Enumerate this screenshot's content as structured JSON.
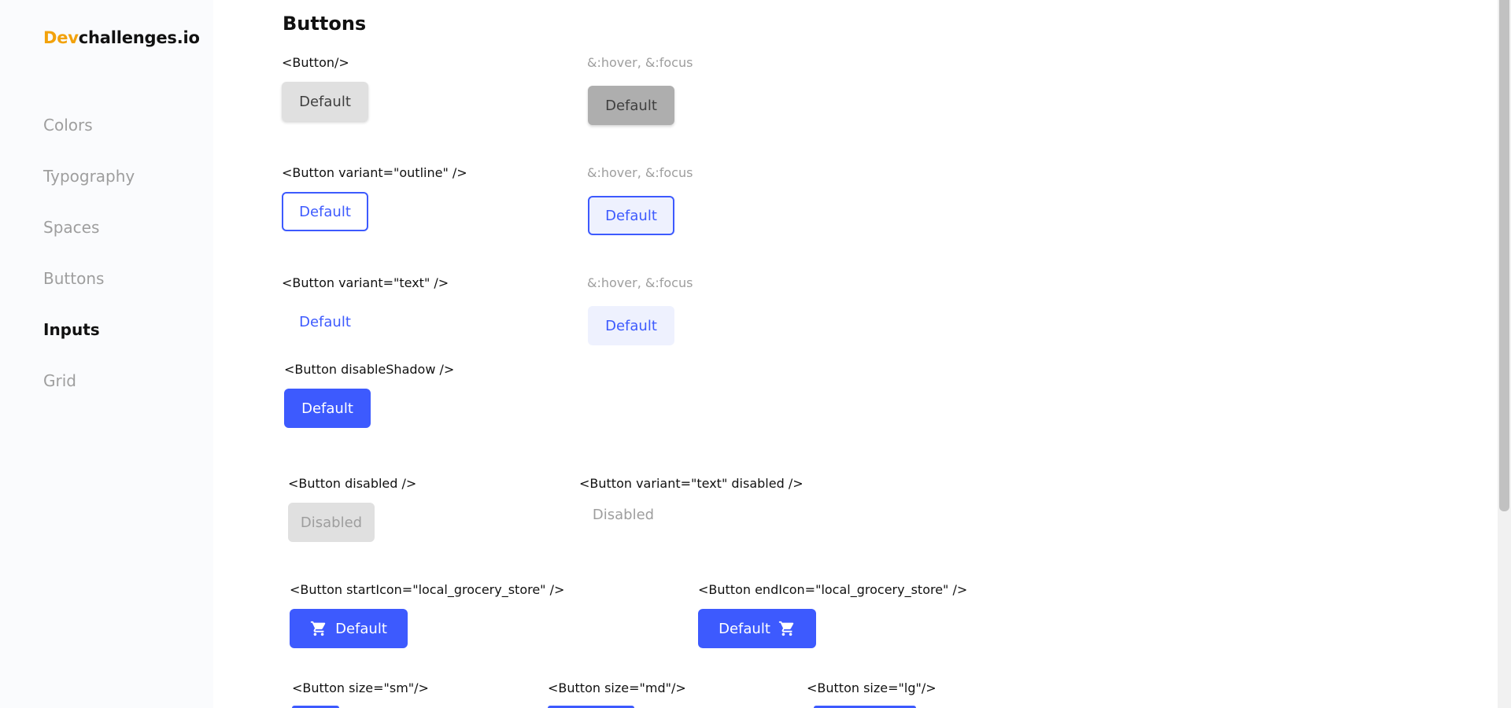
{
  "logo": {
    "accent": "Dev",
    "rest": "challenges.io"
  },
  "sidebar": {
    "items": [
      {
        "label": "Colors",
        "active": false
      },
      {
        "label": "Typography",
        "active": false
      },
      {
        "label": "Spaces",
        "active": false
      },
      {
        "label": "Buttons",
        "active": false
      },
      {
        "label": "Inputs",
        "active": true
      },
      {
        "label": "Grid",
        "active": false
      }
    ]
  },
  "main": {
    "title": "Buttons",
    "sections": {
      "default_code": "<Button/>",
      "outline_code": "<Button variant=\"outline\" />",
      "text_code": "<Button variant=\"text\" />",
      "hover_label": "&:hover, &:focus",
      "disable_shadow_code": "<Button disableShadow />",
      "disabled_code": "<Button disabled />",
      "text_disabled_code": "<Button variant=\"text\" disabled />",
      "start_icon_code": "<Button startIcon=\"local_grocery_store\" />",
      "end_icon_code": "<Button endIcon=\"local_grocery_store\" />",
      "size_sm_code": "<Button size=\"sm\"/>",
      "size_md_code": "<Button size=\"md\"/>",
      "size_lg_code": "<Button size=\"lg\"/>"
    },
    "buttons": {
      "default_label": "Default",
      "disabled_label": "Disabled"
    }
  },
  "colors": {
    "primary": "#3d5afe",
    "accent": "#f2a20c",
    "muted": "#9e9e9e",
    "default_bg": "#e0e0e0",
    "default_hover_bg": "#aeaeae"
  },
  "icons": {
    "cart": "local-grocery-store-icon"
  }
}
